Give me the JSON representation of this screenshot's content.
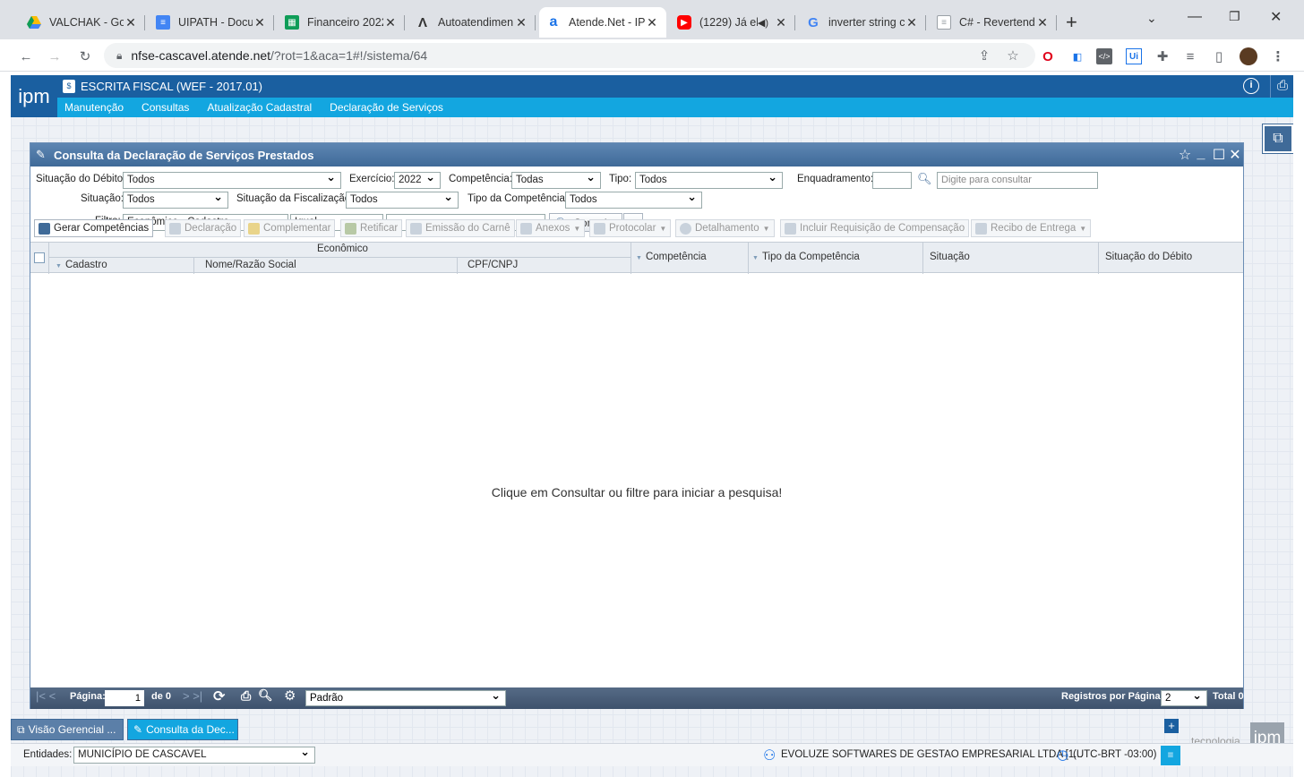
{
  "browser": {
    "tabs": [
      {
        "title": "VALCHAK - Goo",
        "icon": "google-drive-icon",
        "color": "#fbbc04"
      },
      {
        "title": "UIPATH - Docu",
        "icon": "google-docs-icon",
        "color": "#4285f4"
      },
      {
        "title": "Financeiro 2022",
        "icon": "google-sheets-icon",
        "color": "#0f9d58"
      },
      {
        "title": "Autoatendimen",
        "icon": "lambda-icon",
        "color": "#333333"
      },
      {
        "title": "Atende.Net - IP",
        "icon": "atende-icon",
        "color": "#1a73e8"
      },
      {
        "title": "(1229) Já el",
        "icon": "youtube-icon",
        "color": "#ff0000"
      },
      {
        "title": "inverter string c",
        "icon": "google-icon",
        "color": "#4285f4"
      },
      {
        "title": "C# - Revertend",
        "icon": "page-icon",
        "color": "#9aa0a6"
      }
    ],
    "new_tab": "+",
    "url_host": "nfse-cascavel.atende.net",
    "url_path": "/?rot=1&aca=1#!/sistema/64"
  },
  "app": {
    "logo": "ipm",
    "system_title": "ESCRITA FISCAL (WEF - 2017.01)",
    "menu": [
      "Manutenção",
      "Consultas",
      "Atualização Cadastral",
      "Declaração de Serviços"
    ]
  },
  "window": {
    "title": "Consulta da Declaração de Serviços Prestados",
    "filters": {
      "situacao_debito_label": "Situação do Débito:",
      "situacao_debito_value": "Todos",
      "exercicio_label": "Exercício:",
      "exercicio_value": "2022",
      "competencia_label": "Competência:",
      "competencia_value": "Todas",
      "tipo_label": "Tipo:",
      "tipo_value": "Todos",
      "enquadramento_label": "Enquadramento:",
      "consult_placeholder": "Digite para consultar",
      "situacao_label": "Situação:",
      "situacao_value": "Todos",
      "situacao_fisc_label": "Situação da Fiscalização:",
      "situacao_fisc_value": "Todos",
      "tipo_comp_label": "Tipo da Competência:",
      "tipo_comp_value": "Todos",
      "filtro_label": "Filtro:",
      "filtro_value": "Econômico - Cadastro",
      "operador_value": "Igual",
      "consultar_label": "Consultar"
    },
    "actions": [
      "Gerar Competências",
      "Declaração",
      "Complementar",
      "Retificar",
      "Emissão do Carnê",
      "Anexos",
      "Protocolar",
      "Detalhamento",
      "Incluir Requisição de Compensação",
      "Recibo de Entrega"
    ],
    "columns": {
      "group": "Econômico",
      "cadastro": "Cadastro",
      "nome": "Nome/Razão Social",
      "cpf": "CPF/CNPJ",
      "competencia": "Competência",
      "tipo_competencia": "Tipo da Competência",
      "situacao": "Situação",
      "situacao_debito": "Situação do Débito"
    },
    "empty_message": "Clique em Consultar ou filtre para iniciar a pesquisa!",
    "pager": {
      "page_label": "Página:",
      "page_value": "1",
      "of_label": "de 0",
      "layout_value": "Padrão",
      "per_page_label": "Registros por Página:",
      "per_page_value": "2",
      "total_label": "Total 0"
    }
  },
  "taskbar": [
    "Visão Gerencial ...",
    "Consulta da Dec..."
  ],
  "status": {
    "entidades_label": "Entidades:",
    "entidades_value": "MUNICÍPIO DE CASCAVEL",
    "user": "EVOLUZE SOFTWARES DE GESTAO EMPRESARIAL LTDA [1...",
    "timezone": "(UTC-BRT -03:00)",
    "brand": "tecnologia"
  }
}
